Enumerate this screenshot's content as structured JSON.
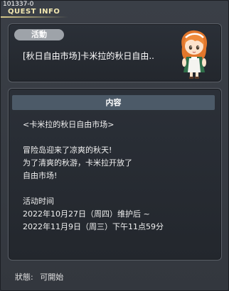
{
  "window": {
    "quest_id": "101337-0",
    "title": "QUEST INFO"
  },
  "event": {
    "tag": "活動",
    "title": "[秋日自由市场]卡米拉的秋日自由.."
  },
  "content": {
    "header": "内容",
    "lines": [
      "<卡米拉的秋日自由市场>",
      "",
      "冒险岛迎来了凉爽的秋天!",
      "为了清爽的秋游，卡米拉开放了",
      "自由市场!",
      "",
      "活动时间",
      "2022年10月27日（周四）维护后  ~",
      "2022年11月9日（周三）下午11点59分"
    ]
  },
  "status": {
    "label": "狀態:",
    "value": "可開始"
  },
  "icons": {
    "npc": "npc-portrait-orange-hair-maid"
  },
  "colors": {
    "title_text": "#f2e7b0",
    "header_bar": "#4c5a68",
    "tag_bg": "#9ea3a9"
  }
}
